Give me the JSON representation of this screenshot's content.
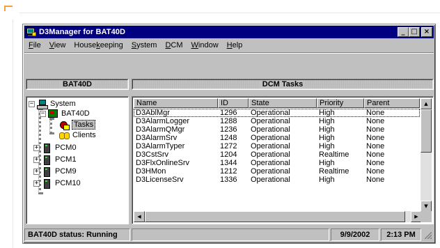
{
  "window": {
    "title": "D3Manager for BAT40D",
    "minimize": "_",
    "maximize": "□",
    "close": "×"
  },
  "menu": [
    {
      "label": "File",
      "accel": "F"
    },
    {
      "label": "View",
      "accel": "V"
    },
    {
      "label": "Housekeeping",
      "accel": "k"
    },
    {
      "label": "System",
      "accel": "S"
    },
    {
      "label": "DCM",
      "accel": "D"
    },
    {
      "label": "Window",
      "accel": "W"
    },
    {
      "label": "Help",
      "accel": "H"
    }
  ],
  "left_pane": {
    "header": "BAT40D",
    "tree": {
      "system": "System",
      "host": "BAT40D",
      "tasks": "Tasks",
      "clients": "Clients",
      "pcm0": "PCM0",
      "pcm1": "PCM1",
      "pcm9": "PCM9",
      "pcm10": "PCM10",
      "expanded": "−",
      "collapsed": "+"
    }
  },
  "right_pane": {
    "header": "DCM Tasks",
    "columns": [
      "Name",
      "ID",
      "State",
      "Priority",
      "Parent"
    ],
    "rows": [
      [
        "D3AblMgr",
        "1296",
        "Operational",
        "High",
        "None"
      ],
      [
        "D3AlarmLogger",
        "1288",
        "Operational",
        "High",
        "None"
      ],
      [
        "D3AlarmQMgr",
        "1236",
        "Operational",
        "High",
        "None"
      ],
      [
        "D3AlarmSrv",
        "1248",
        "Operational",
        "High",
        "None"
      ],
      [
        "D3AlarmTyper",
        "1272",
        "Operational",
        "High",
        "None"
      ],
      [
        "D3CstSrv",
        "1204",
        "Operational",
        "Realtime",
        "None"
      ],
      [
        "D3FlxOnlineSrv",
        "1344",
        "Operational",
        "High",
        "None"
      ],
      [
        "D3HMon",
        "1212",
        "Operational",
        "Realtime",
        "None"
      ],
      [
        "D3LicenseSrv",
        "1336",
        "Operational",
        "High",
        "None"
      ]
    ],
    "scroll_up": "▲",
    "scroll_down": "▼",
    "scroll_left": "◀",
    "scroll_right": "▶"
  },
  "status": {
    "text": "BAT40D status:  Running",
    "middle": "",
    "date": "9/9/2002",
    "time": "2:13 PM"
  }
}
